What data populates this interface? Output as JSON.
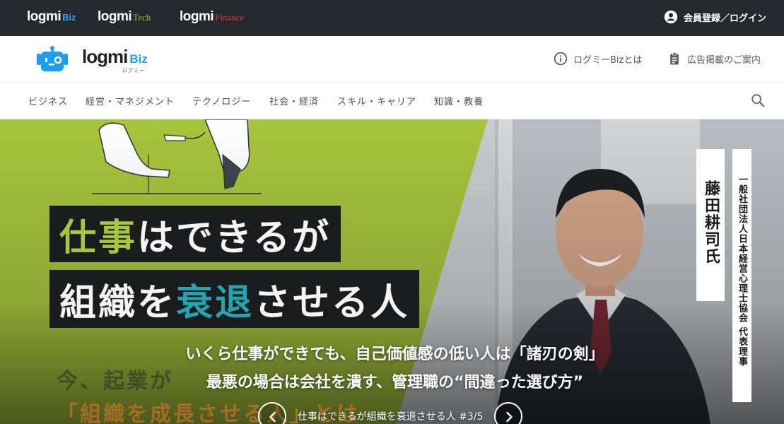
{
  "topbar": {
    "brands": [
      {
        "main": "logmi",
        "sub": "Biz"
      },
      {
        "main": "logmi",
        "sub": "Tech"
      },
      {
        "main": "logmi",
        "sub": "Finance"
      }
    ],
    "login_label": "会員登録／ログイン"
  },
  "header": {
    "logo_main": "logmi",
    "logo_sub": "Biz",
    "logo_kana": "ログミー",
    "about_label": "ログミーBizとは",
    "ads_label": "広告掲載のご案内"
  },
  "nav": {
    "items": [
      {
        "label": "ビジネス"
      },
      {
        "label": "経営・マネジメント"
      },
      {
        "label": "テクノロジー"
      },
      {
        "label": "社会・経済"
      },
      {
        "label": "スキル・キャリア"
      },
      {
        "label": "知識・教養"
      }
    ]
  },
  "hero": {
    "caption_line1_a": "仕事",
    "caption_line1_b": "はできるが",
    "caption_line2_a": "組織を",
    "caption_line2_b": "衰退",
    "caption_line2_c": "させる人",
    "subline_1": "今、起業が",
    "subline_2": "「組織を成長させる人」とは",
    "person_name": "藤田耕司氏",
    "person_org": "一般社団法人日本経営心理士協会 代表理事",
    "headline_1": "いくら仕事ができても、自己価値感の低い人は「諸刃の剣」",
    "headline_2": "最悪の場合は会社を潰す、管理職の“間違った選び方”",
    "series_label": "仕事はできるが組織を衰退させる人 #3/5"
  },
  "colors": {
    "topbar": "#25282c",
    "accent_blue": "#1e9cf0",
    "hero_green": "#a6c63c",
    "tech_green": "#8bc34a",
    "finance_red": "#e53935"
  }
}
